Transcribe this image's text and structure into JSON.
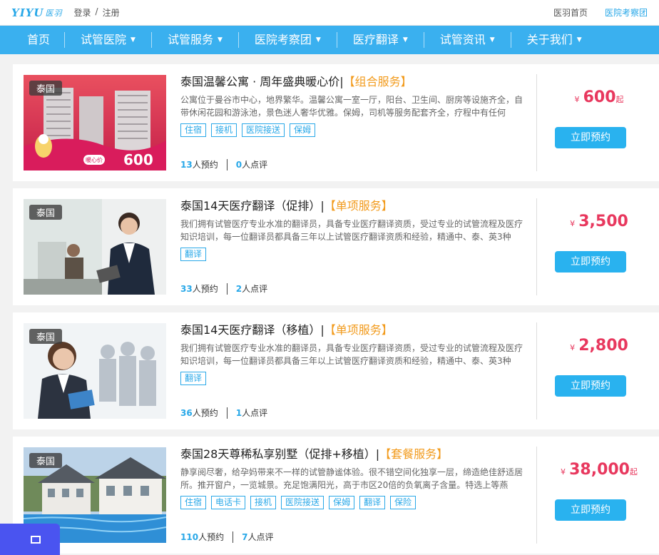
{
  "header": {
    "logo_text": "YIYU",
    "logo_cn": "医羽",
    "login": "登录",
    "divider": "/",
    "register": "注册",
    "home_link": "医羽首页",
    "delegation_link": "医院考察团"
  },
  "nav": {
    "items": [
      {
        "label": "首页",
        "caret": false
      },
      {
        "label": "试管医院",
        "caret": true
      },
      {
        "label": "试管服务",
        "caret": true
      },
      {
        "label": "医院考察团",
        "caret": true
      },
      {
        "label": "医疗翻译",
        "caret": true
      },
      {
        "label": "试管资讯",
        "caret": true
      },
      {
        "label": "关于我们",
        "caret": true
      }
    ]
  },
  "cards": [
    {
      "country": "泰国",
      "title": "泰国温馨公寓 · 周年盛典暖心价|",
      "service_type": "【组合服务】",
      "desc": "公寓位于曼谷市中心，地界繁华。温馨公寓一室一厅，阳台、卫生间、厨房等设施齐全，自带休闲花园和游泳池，景色迷人奢华优雅。保姆，司机等服务配套齐全，疗程中有任何",
      "tags": [
        "住宿",
        "接机",
        "医院接送",
        "保姆"
      ],
      "bookings": "13",
      "bookings_label": "人预约",
      "reviews": "0",
      "reviews_label": "人点评",
      "price_currency": "¥",
      "price": "600",
      "price_suffix": "起",
      "book_label": "立即预约",
      "image_badge_label": "暖心价",
      "image_badge_price": "600"
    },
    {
      "country": "泰国",
      "title": "泰国14天医疗翻译（促排）|",
      "service_type": "【单项服务】",
      "desc": "我们拥有试管医疗专业水准的翻译员，具备专业医疗翻译资质，受过专业的试管流程及医疗知识培训，每一位翻译员都具备三年以上试管医疗翻译资质和经验，精通中、泰、英3种",
      "tags": [
        "翻译"
      ],
      "bookings": "33",
      "bookings_label": "人预约",
      "reviews": "2",
      "reviews_label": "人点评",
      "price_currency": "¥",
      "price": "3,500",
      "price_suffix": "",
      "book_label": "立即预约"
    },
    {
      "country": "泰国",
      "title": "泰国14天医疗翻译（移植）|",
      "service_type": "【单项服务】",
      "desc": "我们拥有试管医疗专业水准的翻译员，具备专业医疗翻译资质，受过专业的试管流程及医疗知识培训，每一位翻译员都具备三年以上试管医疗翻译资质和经验，精通中、泰、英3种",
      "tags": [
        "翻译"
      ],
      "bookings": "36",
      "bookings_label": "人预约",
      "reviews": "1",
      "reviews_label": "人点评",
      "price_currency": "¥",
      "price": "2,800",
      "price_suffix": "",
      "book_label": "立即预约"
    },
    {
      "country": "泰国",
      "title": "泰国28天尊稀私享别墅（促排+移植）|",
      "service_type": "【套餐服务】",
      "desc": "静享阅尽奢，给孕妈带来不一样的试管静谧体验。很不错空间化独享一层，缔造绝佳舒适居所。推开窗户，一览城景。充足饱满阳光，高于市区20倍的负氧离子含量。特选上等燕",
      "tags": [
        "住宿",
        "电话卡",
        "接机",
        "医院接送",
        "保姆",
        "翻译",
        "保险"
      ],
      "bookings": "110",
      "bookings_label": "人预约",
      "reviews": "7",
      "reviews_label": "人点评",
      "price_currency": "¥",
      "price": "38,000",
      "price_suffix": "起",
      "book_label": "立即预约"
    }
  ],
  "colors": {
    "accent": "#29a8e8",
    "nav_bg": "#3ab0ef",
    "price": "#e8385e",
    "service_tag": "#f29b1d",
    "button": "#29b2ef"
  },
  "floating_widget": {
    "icon": "window-icon"
  }
}
